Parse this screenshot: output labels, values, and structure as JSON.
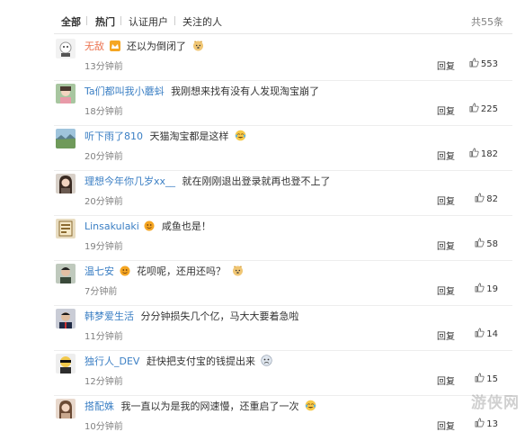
{
  "tabs": [
    "全部",
    "热门",
    "认证用户",
    "关注的人"
  ],
  "total": "共55条",
  "reply_label": "回复",
  "comments": [
    {
      "user": "无敌",
      "text": "还以为倒闭了",
      "time": "13分钟前",
      "likes": "553",
      "badge": "crown-badge",
      "emoji": "doge-emoji"
    },
    {
      "user": "Ta们都叫我小蘑蚪",
      "text": "我刚想来找有没有人发现淘宝崩了",
      "time": "18分钟前",
      "likes": "225"
    },
    {
      "user": "听下雨了810",
      "text": "天猫淘宝都是这样",
      "time": "20分钟前",
      "likes": "182",
      "emoji": "laugh-cry-emoji"
    },
    {
      "user": "理想今年你几岁xx__",
      "text": "就在刚刚退出登录就再也登不上了",
      "time": "20分钟前",
      "likes": "82"
    },
    {
      "user": "Linsakulaki",
      "text": "咸鱼也是！",
      "time": "19分钟前",
      "likes": "58",
      "badge": "vip-badge"
    },
    {
      "user": "温七安",
      "text": "花呗呢，还用还吗？",
      "time": "7分钟前",
      "likes": "19",
      "badge": "vip-badge",
      "emoji": "doge-emoji"
    },
    {
      "user": "韩梦爱生活",
      "text": "分分钟损失几个亿，马大大要着急啦",
      "time": "11分钟前",
      "likes": "14"
    },
    {
      "user": "独行人_DEV",
      "text": "赶快把支付宝的钱提出来",
      "time": "12分钟前",
      "likes": "15",
      "emoji": "sad-emoji"
    },
    {
      "user": "搭配姝",
      "text": "我一直以为是我的网速慢，还重启了一次",
      "time": "10分钟前",
      "likes": "13",
      "emoji": "laugh-cry-emoji"
    }
  ],
  "watermark": "游侠网",
  "colors": {
    "username": "#eb7350",
    "username_blue": "#3b7fc4",
    "meta": "#808080"
  }
}
